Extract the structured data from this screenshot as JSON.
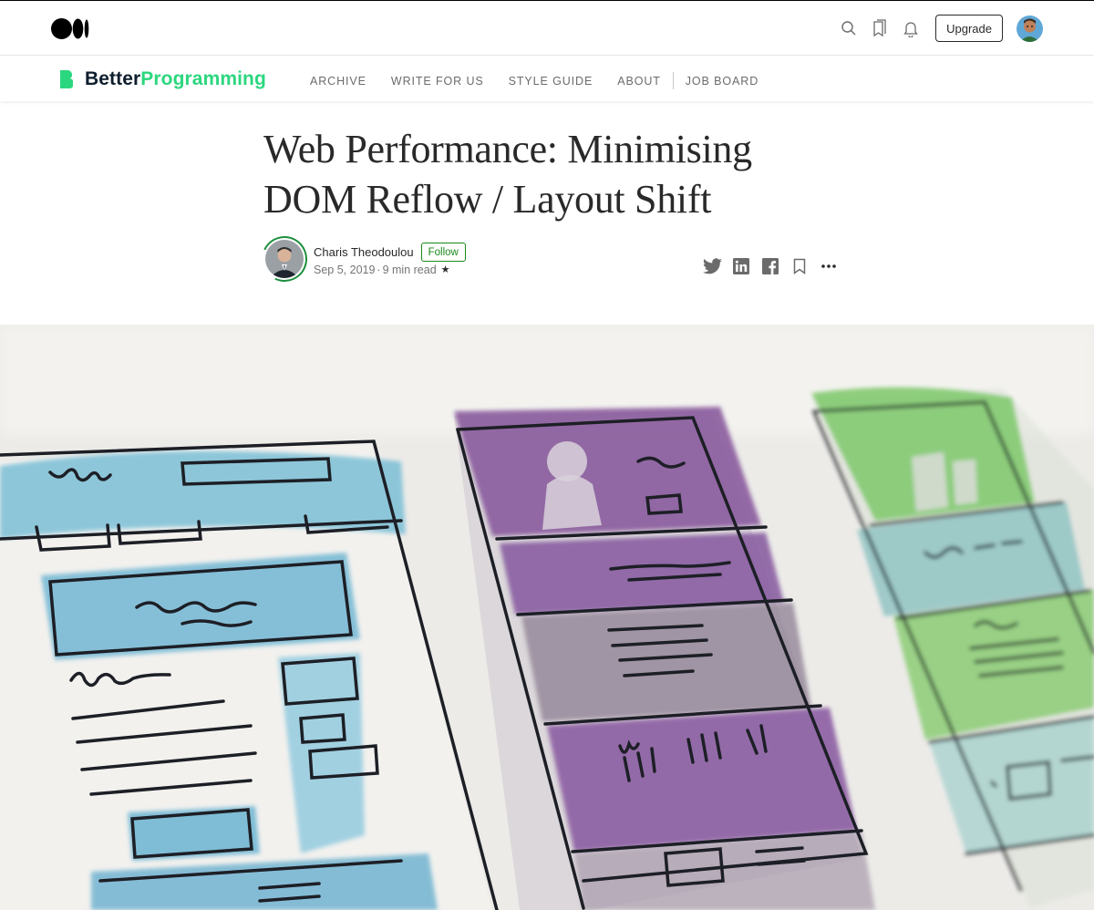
{
  "topbar": {
    "logo_icon": "medium-logo-icon",
    "icons": [
      "search-icon",
      "bookmarks-icon",
      "notifications-bell-icon"
    ],
    "upgrade_label": "Upgrade",
    "avatar_icon": "user-avatar"
  },
  "publication": {
    "name_part1": "Better",
    "name_part2": "Programming",
    "brand_color": "#2bd77e",
    "nav": [
      "ARCHIVE",
      "WRITE FOR US",
      "STYLE GUIDE",
      "ABOUT",
      "JOB BOARD"
    ]
  },
  "article": {
    "title_line1": "Web Performance: Minimising",
    "title_line2": "DOM Reflow / Layout Shift",
    "author": "Charis Theodoulou",
    "follow_label": "Follow",
    "date": "Sep 5, 2019",
    "read_time": "9 min read",
    "separator": "·",
    "star": "★",
    "share_icons": [
      "twitter-icon",
      "linkedin-icon",
      "facebook-icon",
      "bookmark-icon",
      "more-options-icon"
    ]
  },
  "colors": {
    "follow_green": "#1a8917",
    "text": "#292929",
    "muted": "#757575"
  }
}
